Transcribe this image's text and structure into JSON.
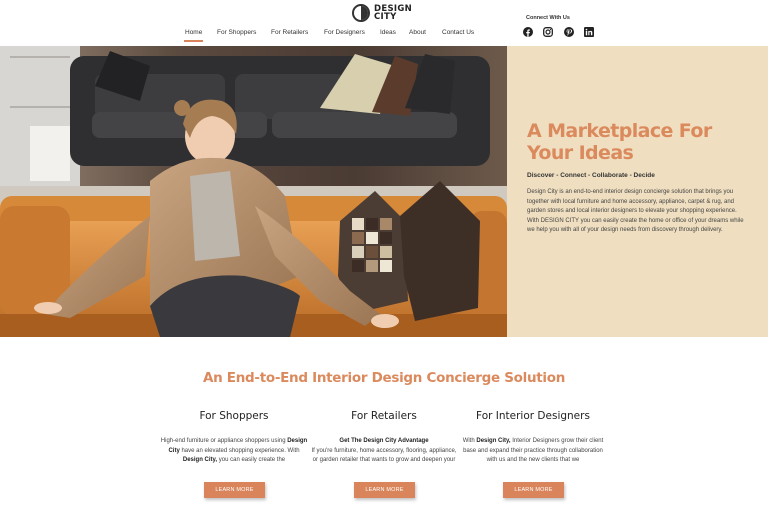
{
  "brand": {
    "name_line1": "DESIGN",
    "name_line2": "CITY"
  },
  "nav": {
    "items": [
      {
        "label": "Home",
        "active": true
      },
      {
        "label": "For Shoppers"
      },
      {
        "label": "For Retailers"
      },
      {
        "label": "For Designers"
      },
      {
        "label": "Ideas"
      },
      {
        "label": "About"
      },
      {
        "label": "Contact Us"
      }
    ]
  },
  "social": {
    "heading": "Connect With Us",
    "icons": [
      "facebook-icon",
      "instagram-icon",
      "pinterest-icon",
      "linkedin-icon"
    ]
  },
  "hero": {
    "title": "A Marketplace For Your Ideas",
    "tagline": "Discover - Connect - Collaborate - Decide",
    "body": "Design City is an end-to-end interior design concierge solution that brings you together with local furniture and home accessory, appliance, carpet & rug, and garden stores and local interior designers to elevate your shopping experience. With DESIGN CITY you can easily create the home or office of your dreams while we help you with all of your design needs from discovery through delivery."
  },
  "section": {
    "title": "An End-to-End Interior Design Concierge Solution",
    "columns": [
      {
        "heading": "For Shoppers",
        "text_1": "High-end furniture or appliance shoppers using ",
        "bold_1": "Design City",
        "text_2": " have an elevated shopping experience. With ",
        "bold_2": "Design City,",
        "text_3": " you can easily create the",
        "button": "LEARN MORE"
      },
      {
        "heading": "For Retailers",
        "bold_1": "Get The Design City Advantage",
        "text_1": "If you're furniture, home accessory, flooring, appliance, or garden retailer that wants to grow and deepen your",
        "button": "LEARN MORE"
      },
      {
        "heading": "For Interior Designers",
        "text_1": "With ",
        "bold_1": "Design City,",
        "text_2": " Interior Designers grow their client base and expand their practice through collaboration with us and the new clients that we",
        "button": "LEARN MORE"
      }
    ]
  },
  "colors": {
    "accent": "#db8a5e",
    "panel": "#efdfc0"
  }
}
